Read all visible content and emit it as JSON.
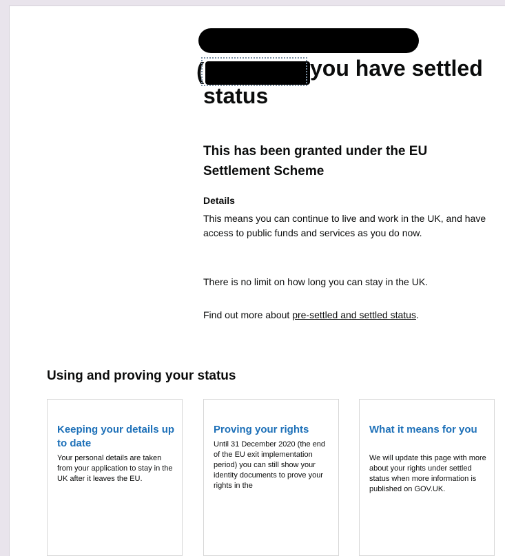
{
  "heading": {
    "paren": "(",
    "line1": "you have settled",
    "line2": "status"
  },
  "subheading": "This has been granted under the EU Settlement Scheme",
  "details": {
    "title": "Details",
    "para1": "This means you can continue to live and work in the UK, and have access to public funds and services as you do now.",
    "para2": "There is no limit on how long you can stay in the UK.",
    "para3_prefix": "Find out more about ",
    "para3_link": "pre-settled and settled status",
    "para3_suffix": "."
  },
  "section": {
    "title": "Using and proving your status",
    "cards": [
      {
        "title": "Keeping your details up to date",
        "body": "Your personal details are taken from your application to stay in the UK after it leaves the EU."
      },
      {
        "title": "Proving your rights",
        "body": "Until 31 December 2020 (the end of the EU exit implementation period) you can still show your identity documents to prove your rights in the"
      },
      {
        "title": "What it means for you",
        "body": "We will update this page with more about your rights under settled status when more information is published on GOV.UK."
      }
    ]
  },
  "colors": {
    "link_blue": "#1d70b8",
    "text": "#0b0c0c",
    "redaction": "#000000"
  }
}
